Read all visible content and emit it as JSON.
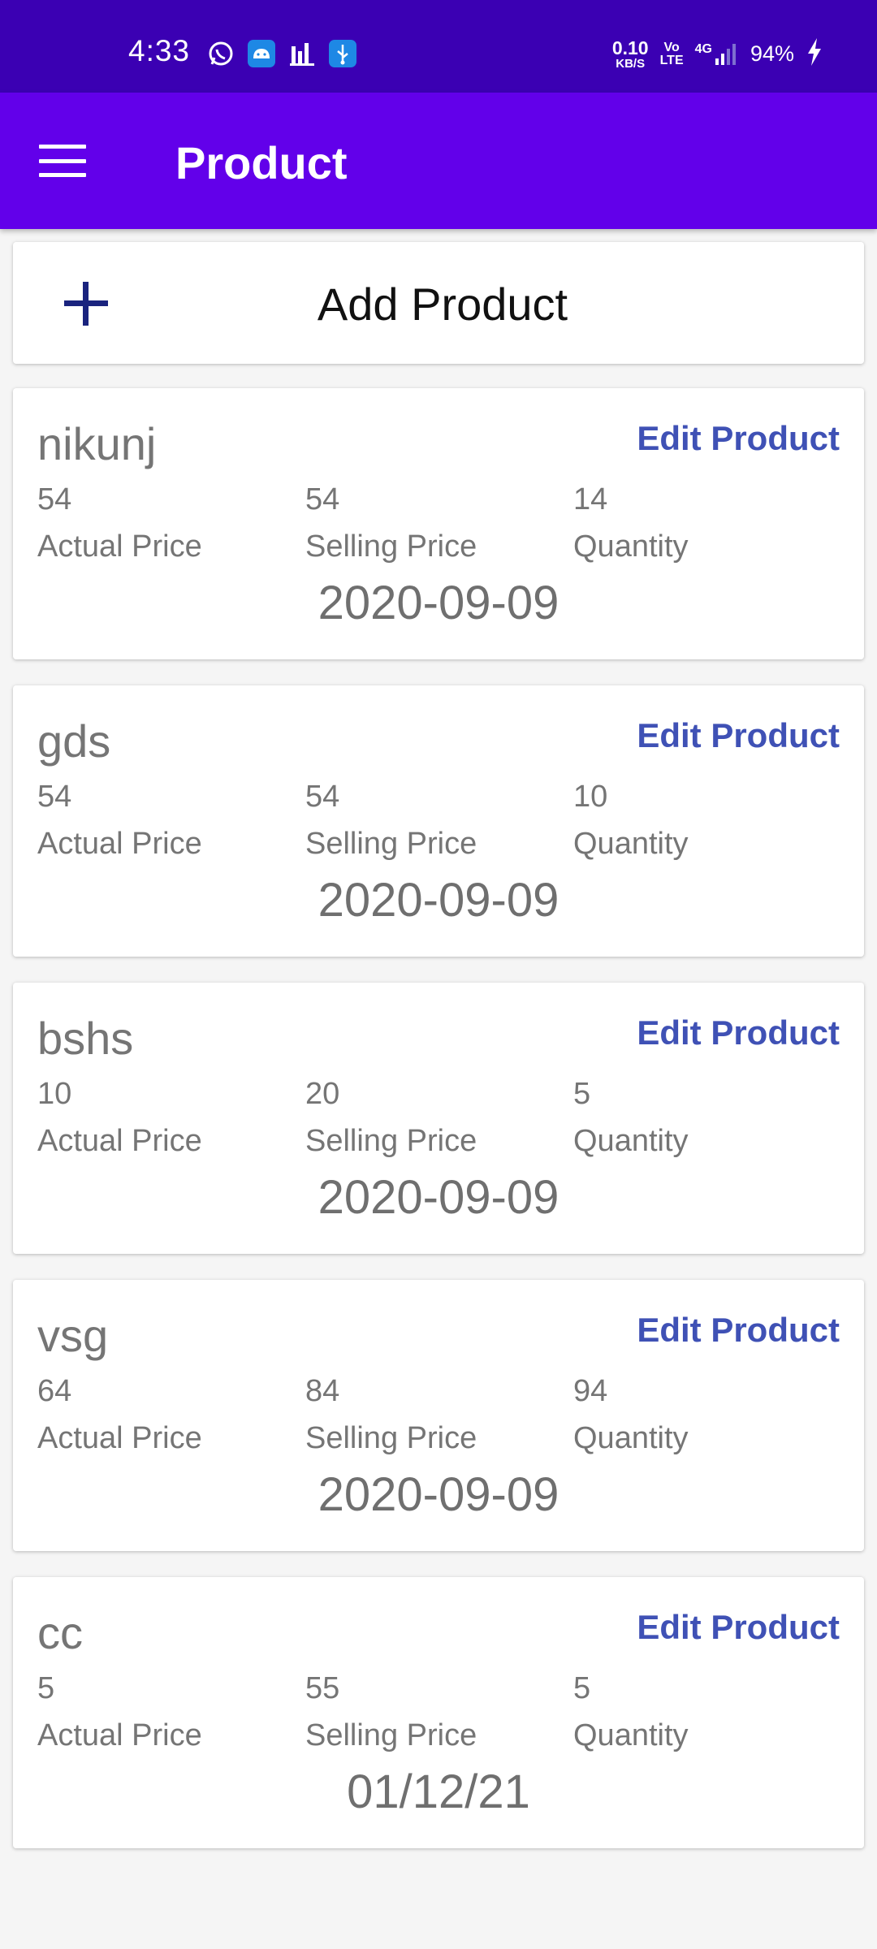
{
  "status_bar": {
    "time": "4:33",
    "net_speed": "0.10",
    "net_speed_unit": "KB/S",
    "volte_top": "Vo",
    "volte_bottom": "LTE",
    "network": "4G",
    "battery": "94%",
    "icons": [
      "whatsapp-icon",
      "android-icon",
      "chart-icon",
      "usb-icon",
      "signal-icon",
      "charging-icon"
    ]
  },
  "app_bar": {
    "title": "Product"
  },
  "add_product": {
    "label": "Add Product"
  },
  "labels": {
    "edit": "Edit Product",
    "actual_price": "Actual Price",
    "selling_price": "Selling Price",
    "quantity": "Quantity"
  },
  "products": [
    {
      "name": "nikunj",
      "actual_price": "54",
      "selling_price": "54",
      "quantity": "14",
      "date": "2020-09-09"
    },
    {
      "name": "gds",
      "actual_price": "54",
      "selling_price": "54",
      "quantity": "10",
      "date": "2020-09-09"
    },
    {
      "name": "bshs",
      "actual_price": "10",
      "selling_price": "20",
      "quantity": "5",
      "date": "2020-09-09"
    },
    {
      "name": "vsg",
      "actual_price": "64",
      "selling_price": "84",
      "quantity": "94",
      "date": "2020-09-09"
    },
    {
      "name": "cc",
      "actual_price": "5",
      "selling_price": "55",
      "quantity": "5",
      "date": "01/12/21"
    }
  ],
  "colors": {
    "status_bar": "#3b00b3",
    "app_bar": "#6200ea",
    "edit_link": "#3f51b5",
    "plus_icon": "#1a237e"
  }
}
